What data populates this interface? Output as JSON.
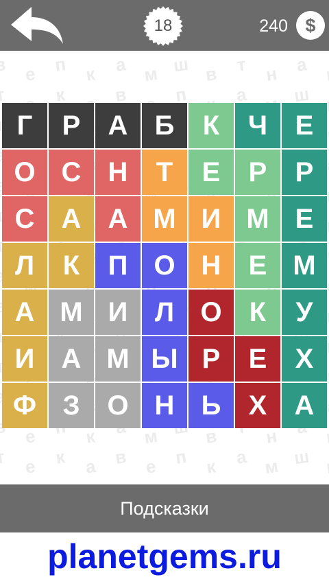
{
  "header": {
    "back_icon": "back-arrow-icon",
    "level": "18",
    "coins": "240",
    "coin_symbol": "$"
  },
  "background_letters": [
    "в",
    "е",
    "п",
    "к",
    "а",
    "м",
    "ш",
    "в",
    "т",
    "н",
    "а",
    "в",
    "т",
    "е",
    "к",
    "а"
  ],
  "grid": {
    "rows": [
      [
        {
          "letter": "Г",
          "color": "#3d3d3d"
        },
        {
          "letter": "Р",
          "color": "#3d3d3d"
        },
        {
          "letter": "А",
          "color": "#3d3d3d"
        },
        {
          "letter": "Б",
          "color": "#3d3d3d"
        },
        {
          "letter": "К",
          "color": "#7dc98f"
        },
        {
          "letter": "Ч",
          "color": "#2e9a86"
        },
        {
          "letter": "Е",
          "color": "#2e9a86"
        }
      ],
      [
        {
          "letter": "О",
          "color": "#e06666"
        },
        {
          "letter": "С",
          "color": "#e06666"
        },
        {
          "letter": "Н",
          "color": "#e06666"
        },
        {
          "letter": "Т",
          "color": "#f6a54b"
        },
        {
          "letter": "Е",
          "color": "#7dc98f"
        },
        {
          "letter": "Р",
          "color": "#7dc98f"
        },
        {
          "letter": "Р",
          "color": "#2e9a86"
        }
      ],
      [
        {
          "letter": "С",
          "color": "#e06666"
        },
        {
          "letter": "А",
          "color": "#d9b04a"
        },
        {
          "letter": "А",
          "color": "#e06666"
        },
        {
          "letter": "М",
          "color": "#f6a54b"
        },
        {
          "letter": "И",
          "color": "#f6a54b"
        },
        {
          "letter": "М",
          "color": "#7dc98f"
        },
        {
          "letter": "Е",
          "color": "#2e9a86"
        }
      ],
      [
        {
          "letter": "Л",
          "color": "#d9b04a"
        },
        {
          "letter": "К",
          "color": "#d9b04a"
        },
        {
          "letter": "П",
          "color": "#5b5bea"
        },
        {
          "letter": "О",
          "color": "#5b5bea"
        },
        {
          "letter": "Н",
          "color": "#f6a54b"
        },
        {
          "letter": "Е",
          "color": "#7dc98f"
        },
        {
          "letter": "М",
          "color": "#2e9a86"
        }
      ],
      [
        {
          "letter": "А",
          "color": "#d9b04a"
        },
        {
          "letter": "М",
          "color": "#aaaaaa"
        },
        {
          "letter": "И",
          "color": "#aaaaaa"
        },
        {
          "letter": "Л",
          "color": "#5b5bea"
        },
        {
          "letter": "О",
          "color": "#b0262c"
        },
        {
          "letter": "К",
          "color": "#7dc98f"
        },
        {
          "letter": "У",
          "color": "#2e9a86"
        }
      ],
      [
        {
          "letter": "И",
          "color": "#d9b04a"
        },
        {
          "letter": "А",
          "color": "#aaaaaa"
        },
        {
          "letter": "М",
          "color": "#aaaaaa"
        },
        {
          "letter": "Ы",
          "color": "#5b5bea"
        },
        {
          "letter": "Р",
          "color": "#b0262c"
        },
        {
          "letter": "Е",
          "color": "#b0262c"
        },
        {
          "letter": "Х",
          "color": "#2e9a86"
        }
      ],
      [
        {
          "letter": "Ф",
          "color": "#d9b04a"
        },
        {
          "letter": "З",
          "color": "#aaaaaa"
        },
        {
          "letter": "О",
          "color": "#aaaaaa"
        },
        {
          "letter": "Н",
          "color": "#5b5bea"
        },
        {
          "letter": "Ь",
          "color": "#5b5bea"
        },
        {
          "letter": "Х",
          "color": "#b0262c"
        },
        {
          "letter": "А",
          "color": "#2e9a86"
        }
      ]
    ]
  },
  "hints": {
    "label": "Подсказки"
  },
  "watermark": {
    "text": "planetgems.ru",
    "color": "#0c1be0"
  }
}
